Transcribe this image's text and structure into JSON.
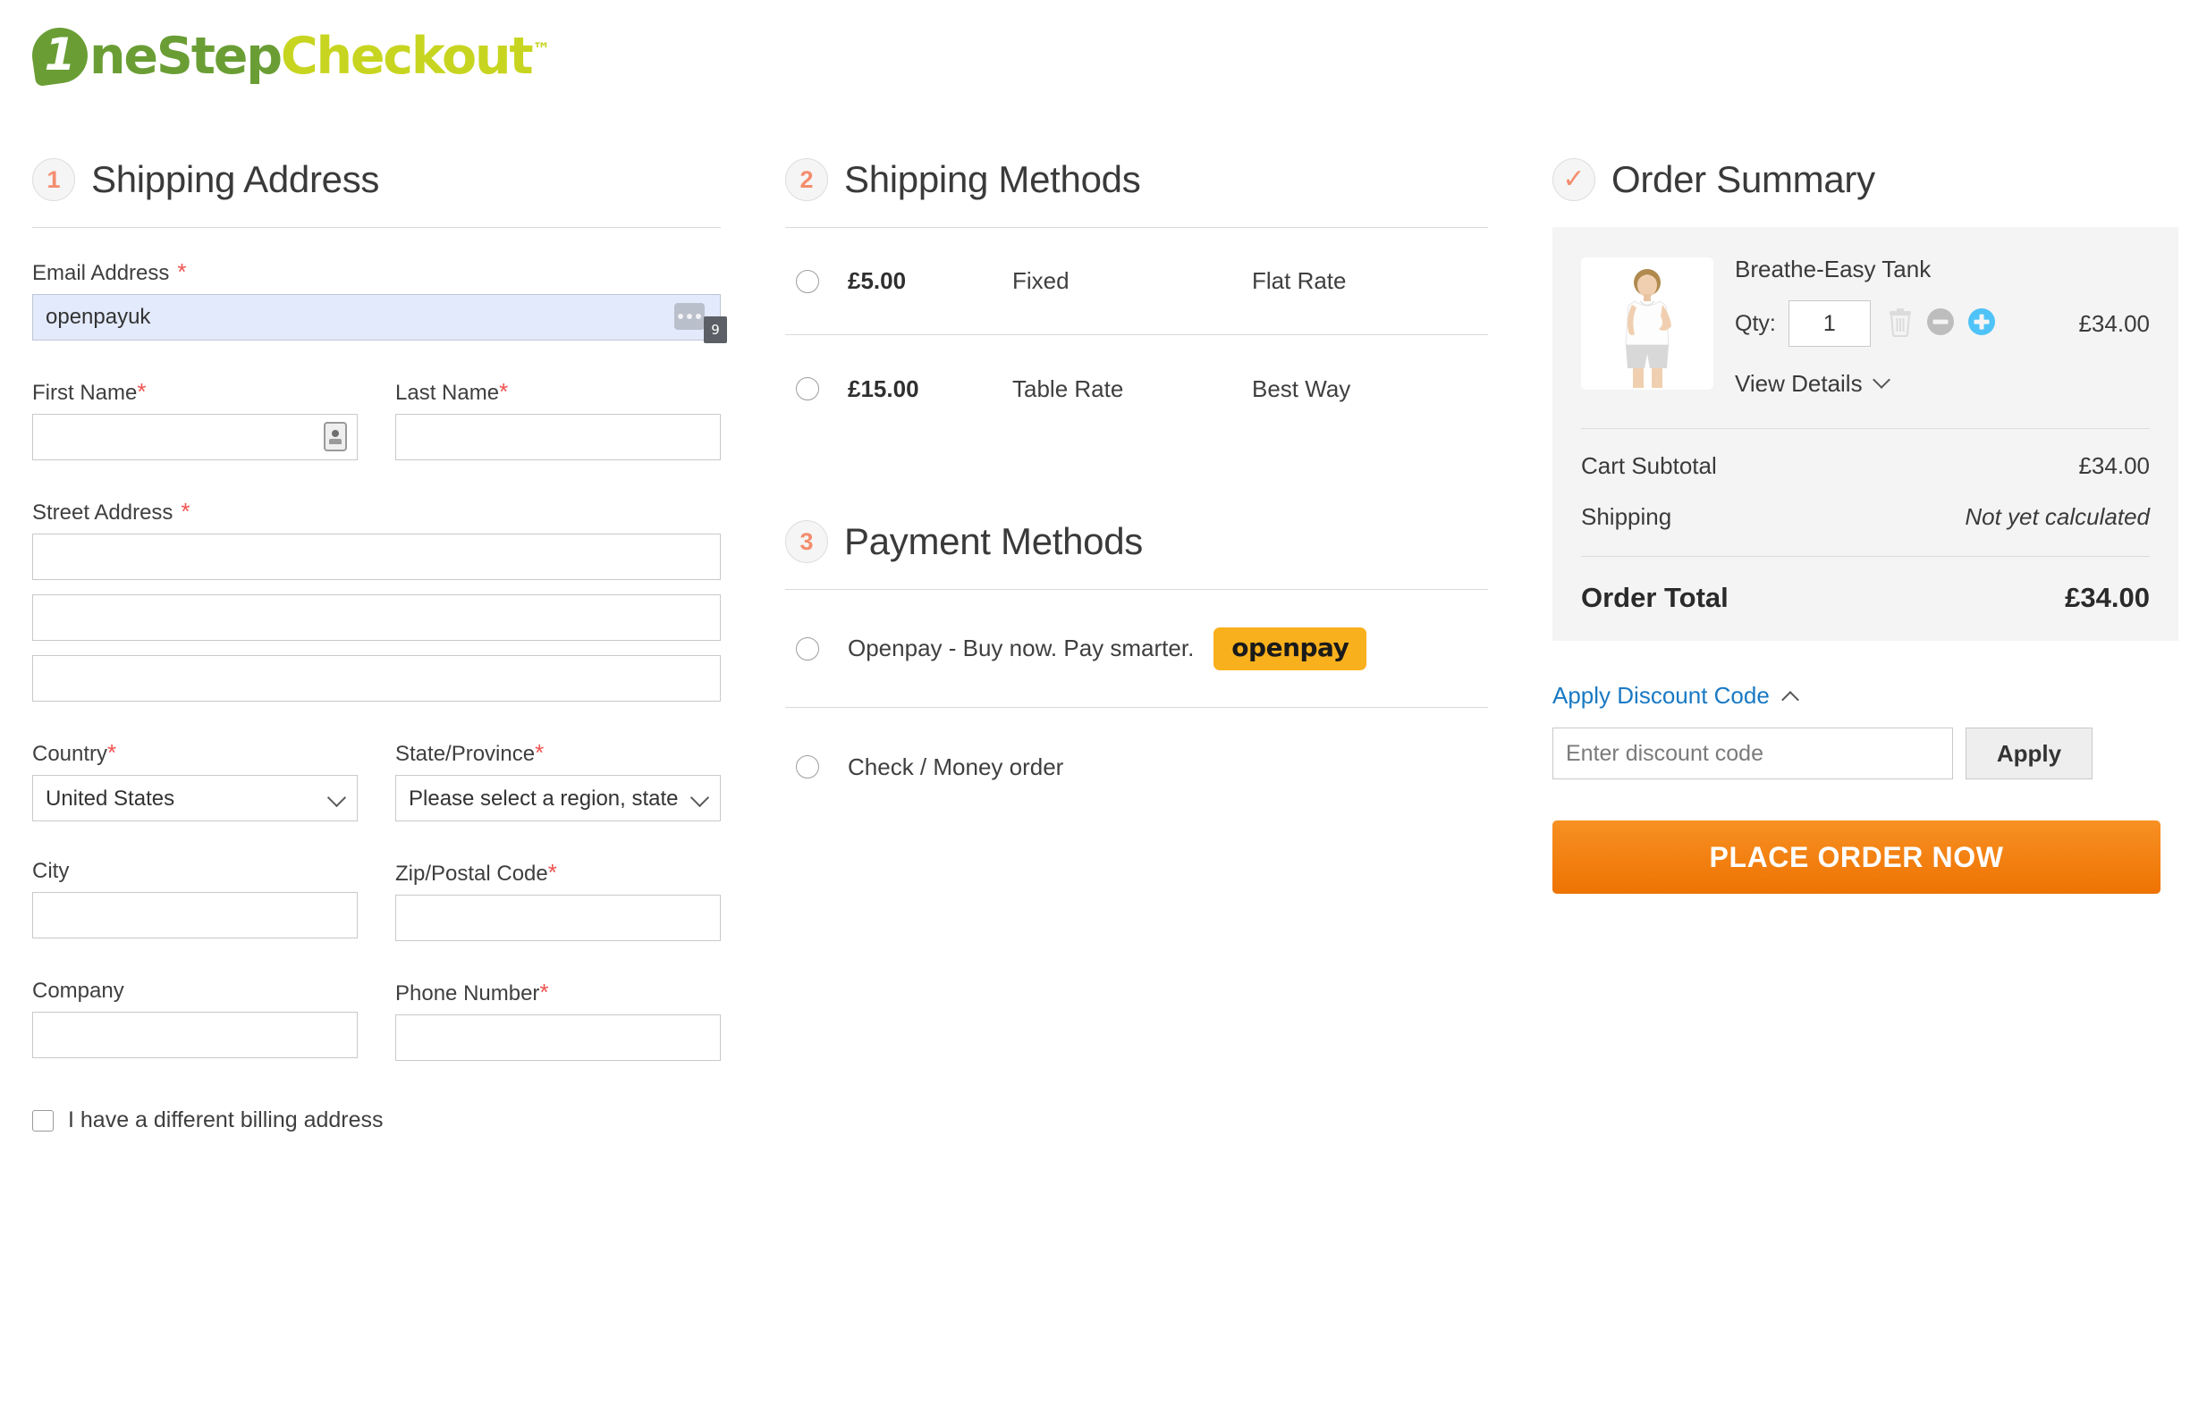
{
  "brand": {
    "name_part1": "ne",
    "name_part2": "Step",
    "name_part3": "Checkout",
    "numeral": "1",
    "tm": "™",
    "green": "#6a9e35",
    "lime": "#c8d520"
  },
  "shipping_address": {
    "step": "1",
    "title": "Shipping Address",
    "email_label": "Email Address",
    "email_required": "*",
    "email_value": "openpayuk",
    "email_autofill_badge": "9",
    "first_name_label": "First Name",
    "first_name_required": "*",
    "first_name_value": "",
    "last_name_label": "Last Name",
    "last_name_required": "*",
    "last_name_value": "",
    "street_label": "Street Address",
    "street_required": "*",
    "street_line1": "",
    "street_line2": "",
    "street_line3": "",
    "country_label": "Country",
    "country_required": "*",
    "country_value": "United States",
    "state_label": "State/Province",
    "state_required": "*",
    "state_value": "Please select a region, state or province.",
    "city_label": "City",
    "city_value": "",
    "zip_label": "Zip/Postal Code",
    "zip_required": "*",
    "zip_value": "",
    "company_label": "Company",
    "company_value": "",
    "phone_label": "Phone Number",
    "phone_required": "*",
    "phone_value": "",
    "billing_checkbox_label": "I have a different billing address"
  },
  "shipping_methods": {
    "step": "2",
    "title": "Shipping Methods",
    "options": [
      {
        "price": "£5.00",
        "carrier": "Fixed",
        "name": "Flat Rate",
        "selected": false
      },
      {
        "price": "£15.00",
        "carrier": "Table Rate",
        "name": "Best Way",
        "selected": false
      }
    ]
  },
  "payment_methods": {
    "step": "3",
    "title": "Payment Methods",
    "options": [
      {
        "label": "Openpay - Buy now. Pay smarter.",
        "badge": "openpay",
        "badge_color": "#f8b01d",
        "selected": false
      },
      {
        "label": "Check / Money order",
        "badge": "",
        "selected": false
      }
    ]
  },
  "order_summary": {
    "step_icon": "✓",
    "title": "Order Summary",
    "product": {
      "name": "Breathe-Easy Tank",
      "qty_label": "Qty:",
      "qty_value": "1",
      "price": "£34.00",
      "view_details": "View Details"
    },
    "totals": [
      {
        "label": "Cart Subtotal",
        "value": "£34.00",
        "italic": false
      },
      {
        "label": "Shipping",
        "value": "Not yet calculated",
        "italic": true
      }
    ],
    "order_total_label": "Order Total",
    "order_total_value": "£34.00",
    "discount_link": "Apply Discount Code",
    "discount_placeholder": "Enter discount code",
    "discount_value": "",
    "apply_label": "Apply",
    "place_order_label": "PLACE ORDER NOW"
  }
}
